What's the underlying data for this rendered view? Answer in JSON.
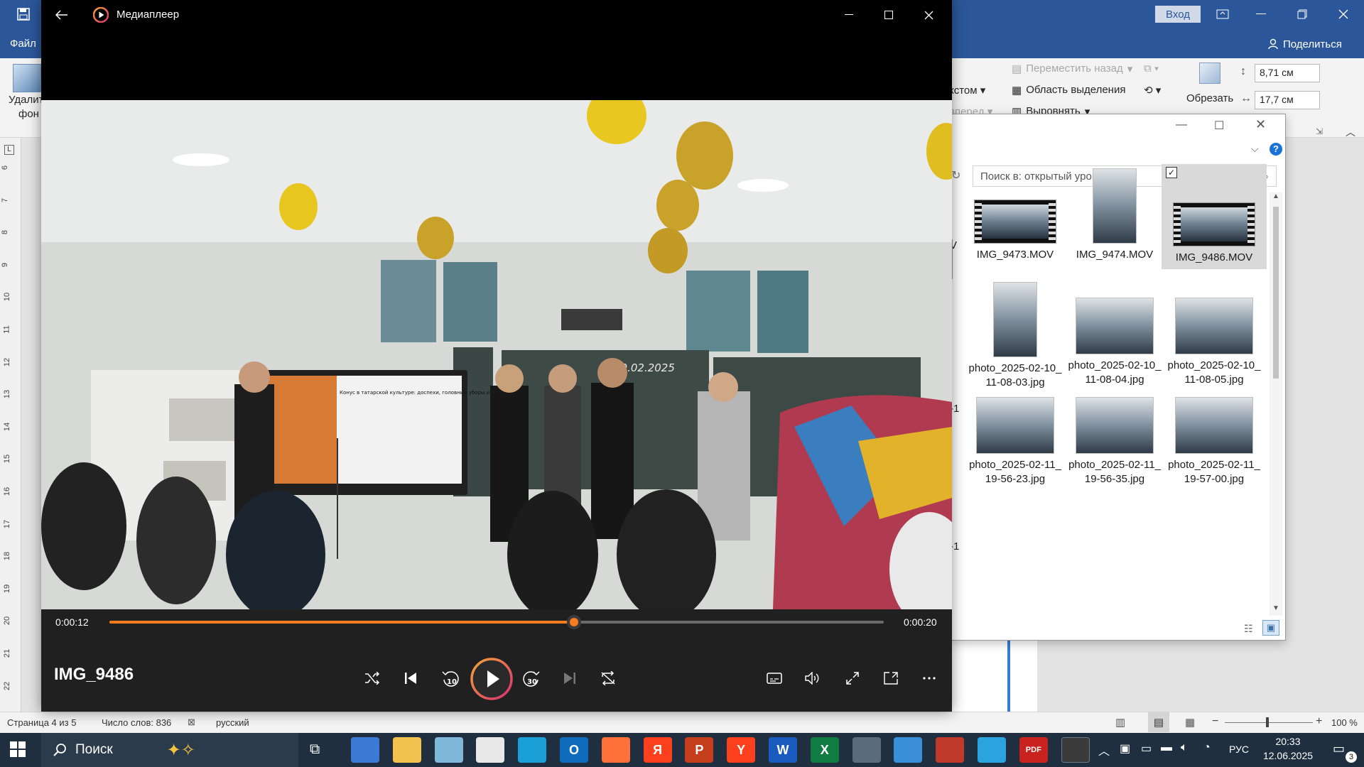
{
  "word": {
    "signin_label": "Вход",
    "share_label": "Поделиться",
    "file_tab": "Файл",
    "remove_bg_line1": "Удалить",
    "remove_bg_line2": "фон",
    "send_backward": "Переместить назад",
    "selection_pane": "Область выделения",
    "align": "Выровнять",
    "wrap_text_partial": "кстом",
    "bring_forward_partial": "вперед",
    "crop_label": "Обрезать",
    "height_value": "8,71 см",
    "width_value": "17,7 см",
    "ruler_numbers": [
      "6",
      "7",
      "8",
      "9",
      "10",
      "11",
      "12",
      "13",
      "14",
      "15",
      "16",
      "17",
      "18",
      "19",
      "20",
      "21",
      "22"
    ],
    "status": {
      "page": "Страница 4 из 5",
      "words": "Число слов: 836",
      "language": "русский",
      "zoom": "100 %"
    }
  },
  "explorer": {
    "search_placeholder": "Поиск в: открытый урок",
    "items": [
      {
        "name": "IMG_9473.MOV",
        "kind": "video",
        "selected": false
      },
      {
        "name": "IMG_9474.MOV",
        "kind": "portrait",
        "selected": false
      },
      {
        "name": "IMG_9486.MOV",
        "kind": "video",
        "selected": true
      },
      {
        "name": "photo_2025-02-10_11-08-03.jpg",
        "kind": "portrait",
        "selected": false
      },
      {
        "name": "photo_2025-02-10_11-08-04.jpg",
        "kind": "photo",
        "selected": false
      },
      {
        "name": "photo_2025-02-10_11-08-05.jpg",
        "kind": "photo",
        "selected": false
      },
      {
        "name": "photo_2025-02-11_19-56-23.jpg",
        "kind": "photo",
        "selected": false
      },
      {
        "name": "photo_2025-02-11_19-56-35.jpg",
        "kind": "photo",
        "selected": false
      },
      {
        "name": "photo_2025-02-11_19-57-00.jpg",
        "kind": "photo",
        "selected": false
      }
    ],
    "partial_left_labels": [
      "V",
      "-1",
      "-1"
    ]
  },
  "player": {
    "app_title": "Медиаплеер",
    "current_time": "0:00:12",
    "total_time": "0:00:20",
    "progress": 0.6,
    "media_title": "IMG_9486",
    "skip_back_label": "10",
    "skip_forward_label": "30",
    "slide_title": "Конус в татарской культуре: доспехи, головные уборы и декор",
    "board_date": "10.02.2025",
    "accent": "#f57c1f"
  },
  "taskbar": {
    "search_label": "Поиск",
    "language": "РУС",
    "time": "20:33",
    "date": "12.06.2025",
    "notification_count": "3",
    "apps": [
      {
        "name": "copilot",
        "glyph": "",
        "color": "#3b7bd6"
      },
      {
        "name": "file-explorer",
        "glyph": "",
        "color": "#f2c14e"
      },
      {
        "name": "notes",
        "glyph": "",
        "color": "#7fb8d8"
      },
      {
        "name": "store",
        "glyph": "",
        "color": "#e8e8e8"
      },
      {
        "name": "edge",
        "glyph": "",
        "color": "#1a9fd6"
      },
      {
        "name": "outlook",
        "glyph": "O",
        "color": "#0f6cbd"
      },
      {
        "name": "firefox",
        "glyph": "",
        "color": "#ff7139"
      },
      {
        "name": "yandex-browser",
        "glyph": "Я",
        "color": "#fc3f1d"
      },
      {
        "name": "powerpoint",
        "glyph": "P",
        "color": "#c43e1c"
      },
      {
        "name": "yandex",
        "glyph": "Y",
        "color": "#fc3f1d"
      },
      {
        "name": "word",
        "glyph": "W",
        "color": "#185abd"
      },
      {
        "name": "excel",
        "glyph": "X",
        "color": "#107c41"
      },
      {
        "name": "calculator",
        "glyph": "",
        "color": "#5a6b7b"
      },
      {
        "name": "photos",
        "glyph": "",
        "color": "#3a8fd8"
      },
      {
        "name": "mosaic-app",
        "glyph": "",
        "color": "#c0392b"
      },
      {
        "name": "telegram",
        "glyph": "",
        "color": "#2aa3df"
      },
      {
        "name": "pdf-app",
        "glyph": "PDF",
        "color": "#c8231f"
      },
      {
        "name": "media-player",
        "glyph": "",
        "color": "#3a3a3a"
      }
    ]
  }
}
